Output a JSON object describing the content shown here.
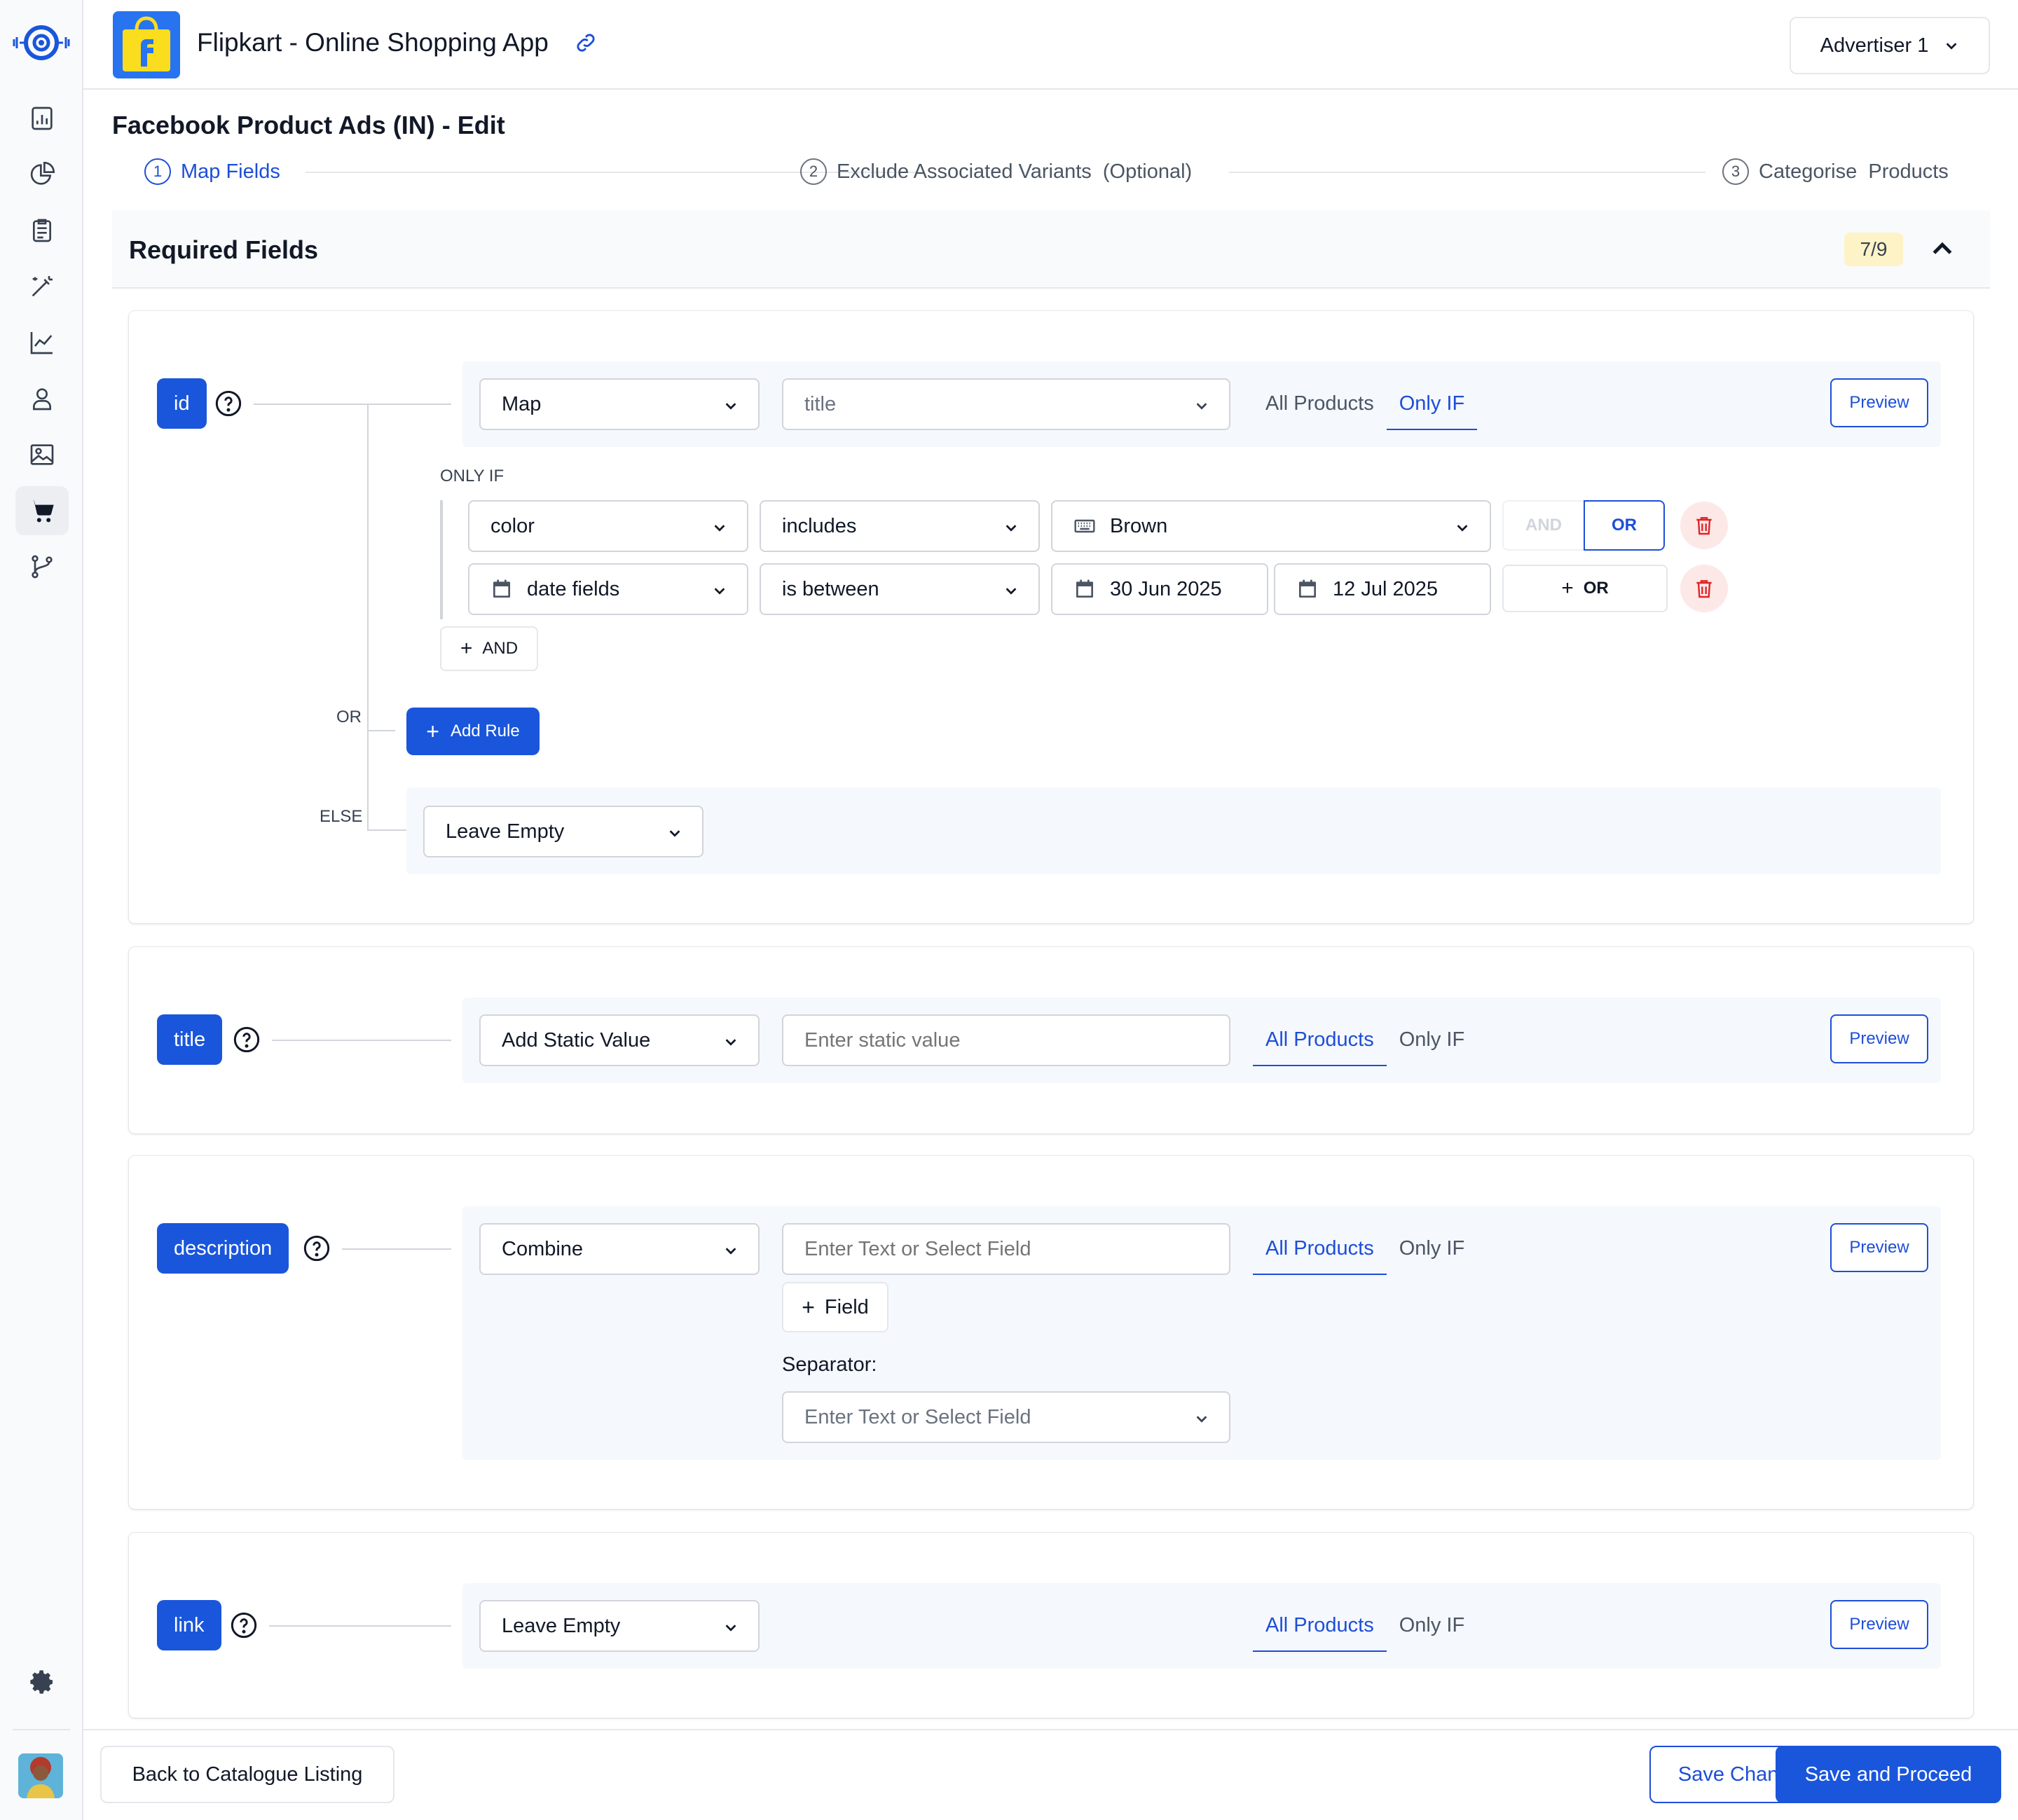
{
  "app": {
    "title": "Flipkart - Online Shopping App",
    "advertiser": "Advertiser 1"
  },
  "page": {
    "title": "Facebook Product Ads (IN) - Edit"
  },
  "steps": [
    {
      "num": "1",
      "label": "Map Fields"
    },
    {
      "num": "2",
      "label": "Exclude Associated Variants  (Optional)"
    },
    {
      "num": "3",
      "label": "Categorise  Products"
    }
  ],
  "section": {
    "title": "Required Fields",
    "count": "7/9"
  },
  "tabs": {
    "all": "All Products",
    "only": "Only IF"
  },
  "preview_label": "Preview",
  "fields": {
    "id": {
      "tag": "id",
      "mode": "Map",
      "value_placeholder": "title",
      "only_if_label": "ONLY IF",
      "conditions": [
        {
          "field": "color",
          "op": "includes",
          "value": "Brown"
        },
        {
          "field": "date fields",
          "op": "is between",
          "from": "30 Jun 2025",
          "to": "12 Jul 2025"
        }
      ],
      "and_label": "AND",
      "or_label": "OR",
      "add_or_label": "OR",
      "add_and_label": "AND",
      "or_connector": "OR",
      "add_rule_label": "Add Rule",
      "else_label": "ELSE",
      "else_value": "Leave Empty"
    },
    "title": {
      "tag": "title",
      "mode": "Add Static Value",
      "placeholder": "Enter static value"
    },
    "description": {
      "tag": "description",
      "mode": "Combine",
      "placeholder": "Enter Text or Select Field",
      "add_field_label": "Field",
      "separator_label": "Separator:",
      "separator_placeholder": "Enter Text or Select Field"
    },
    "link": {
      "tag": "link",
      "mode": "Leave Empty"
    }
  },
  "footer": {
    "back": "Back to Catalogue Listing",
    "save": "Save Changes",
    "proceed": "Save and Proceed"
  },
  "colors": {
    "primary": "#1a56db",
    "badge_bg": "#fef3c7",
    "danger": "#e02424",
    "panel": "#f5f8fc"
  }
}
